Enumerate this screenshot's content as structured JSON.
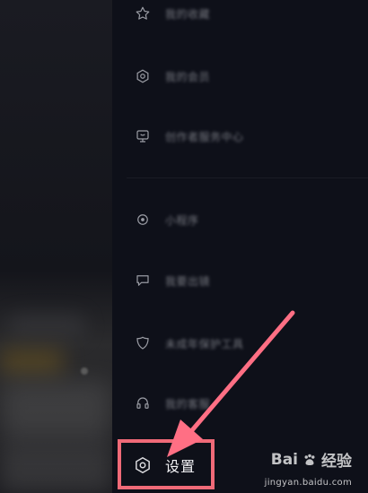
{
  "menu": {
    "items": [
      {
        "icon": "star-icon",
        "label": "我的收藏"
      },
      {
        "icon": "hexagon-icon",
        "label": "我的会员"
      },
      {
        "icon": "cart-icon",
        "label": "创作者服务中心"
      },
      {
        "icon": "gear-icon",
        "label": "小程序"
      },
      {
        "icon": "chat-icon",
        "label": "我要出镜"
      },
      {
        "icon": "shield-icon",
        "label": "未成年保护工具"
      },
      {
        "icon": "headset-icon",
        "label": "我的客服"
      }
    ],
    "settings": {
      "icon": "settings-hexagon-icon",
      "label": "设置"
    }
  },
  "watermark": {
    "brand": "Bai",
    "brand2": "经验",
    "url": "jingyan.baidu.com"
  },
  "colors": {
    "highlight": "#f06a78",
    "drawer_bg": "#0e1019"
  }
}
